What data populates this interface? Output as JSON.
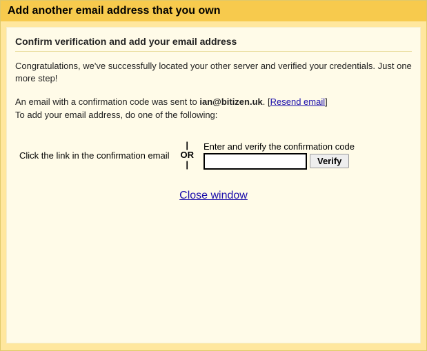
{
  "header": {
    "title": "Add another email address that you own"
  },
  "subheader": "Confirm verification and add your email address",
  "congrats_text": "Congratulations, we've successfully located your other server and verified your credentials. Just one more step!",
  "confirmation_prefix": "An email with a confirmation code was sent to ",
  "email": "ian@bitizen.uk",
  "period": ". ",
  "bracket_open": "[",
  "resend_label": "Resend email",
  "bracket_close": "]",
  "instruction_line": "To add your email address, do one of the following:",
  "left_choice": "Click the link in the confirmation email",
  "or_label": "|\nOR\n|",
  "right_choice_label": "Enter and verify the confirmation code",
  "code_value": "",
  "verify_label": "Verify",
  "close_label": "Close window"
}
